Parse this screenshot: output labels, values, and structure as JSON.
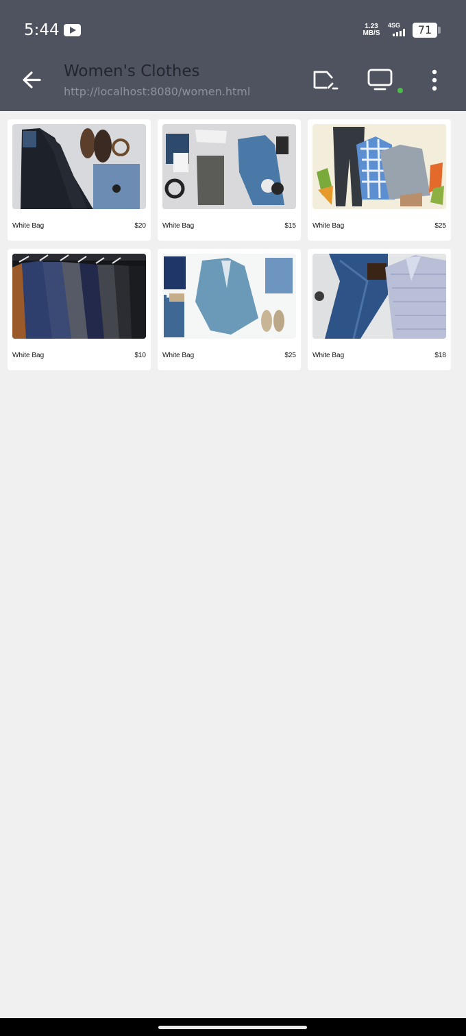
{
  "status_bar": {
    "time": "5:44",
    "net_speed_value": "1.23",
    "net_speed_unit": "MB/S",
    "network_type": "4SG",
    "battery_level": "71",
    "icons": [
      "youtube-icon",
      "signal-icon",
      "battery-icon"
    ]
  },
  "app_bar": {
    "title": "Women's Clothes",
    "url": "http://localhost:8080/women.html",
    "icons": [
      "back-arrow-icon",
      "cast-icon",
      "monitor-icon",
      "more-vertical-icon"
    ],
    "status_dot_color": "#4cbb4c"
  },
  "products": [
    {
      "name": "White Bag",
      "price": "$20",
      "image": "flatlay-black-jacket-jeans-shoes"
    },
    {
      "name": "White Bag",
      "price": "$15",
      "image": "flatlay-denim-jacket-headphones"
    },
    {
      "name": "White Bag",
      "price": "$25",
      "image": "illustration-plaid-shirt-sweater-leaves"
    },
    {
      "name": "White Bag",
      "price": "$10",
      "image": "rack-of-suit-jackets"
    },
    {
      "name": "White Bag",
      "price": "$25",
      "image": "flatlay-blue-blazer-jeans-shoes"
    },
    {
      "name": "White Bag",
      "price": "$18",
      "image": "jeans-belt-and-shirts"
    }
  ],
  "colors": {
    "app_bar_bg": "#4f535f",
    "page_bg": "#f0f0f0",
    "card_bg": "#ffffff"
  }
}
